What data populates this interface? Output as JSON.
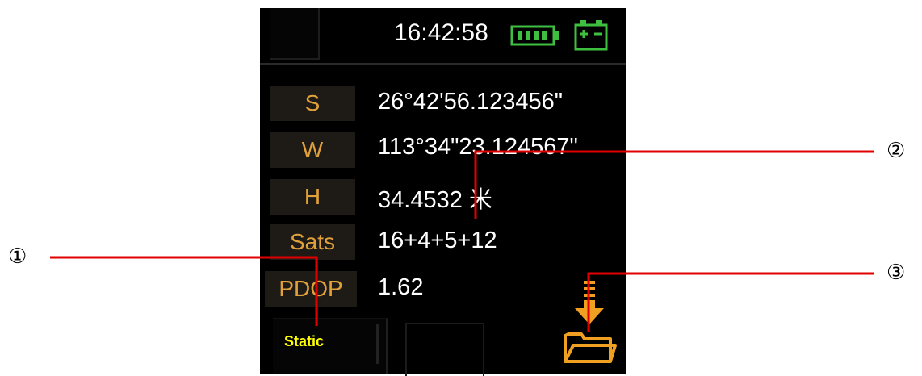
{
  "status_bar": {
    "time": "16:42:58",
    "battery_icon": "battery-icon",
    "power_icon": "external-power-icon"
  },
  "readings": [
    {
      "label": "S",
      "value": "26°42'56.123456\""
    },
    {
      "label": "W",
      "value": "113°34\"23.124567\""
    },
    {
      "label": "H",
      "value": "34.4532 米"
    },
    {
      "label": "Sats",
      "value": "16+4+5+12"
    },
    {
      "label": "PDOP",
      "value": "1.62"
    }
  ],
  "mode_button": {
    "label": "Static"
  },
  "folder_button": {
    "icon": "folder-download-icon"
  },
  "callouts": [
    "①",
    "②",
    "③"
  ],
  "colors": {
    "screen_bg": "#000000",
    "label_text": "#e0a13a",
    "label_bg": "#1e1a16",
    "value_text": "#ffffff",
    "battery": "#3fbf3f",
    "mode_text": "#ffff00",
    "folder": "#f0a020",
    "callout_line": "#e00000"
  }
}
